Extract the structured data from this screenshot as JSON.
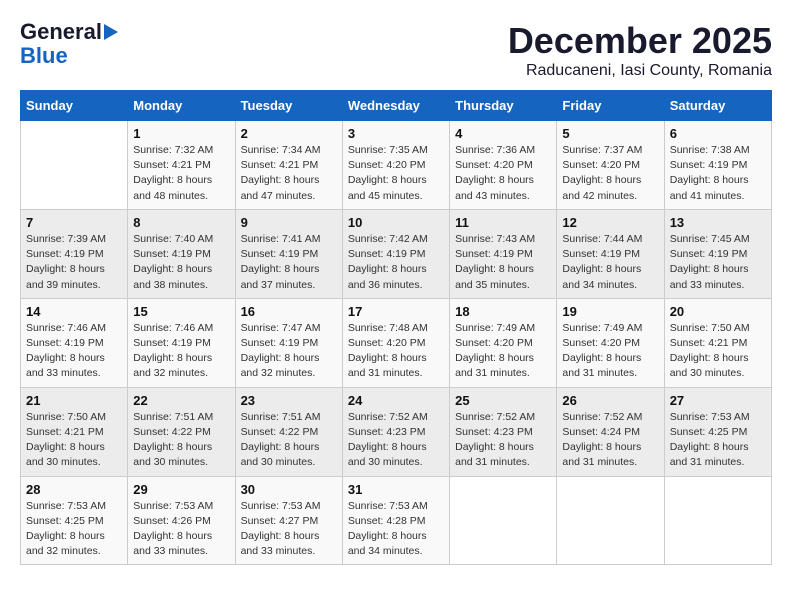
{
  "logo": {
    "line1": "General",
    "line2": "Blue"
  },
  "header": {
    "month": "December 2025",
    "location": "Raducaneni, Iasi County, Romania"
  },
  "weekdays": [
    "Sunday",
    "Monday",
    "Tuesday",
    "Wednesday",
    "Thursday",
    "Friday",
    "Saturday"
  ],
  "weeks": [
    [
      {
        "day": "",
        "sunrise": "",
        "sunset": "",
        "daylight": ""
      },
      {
        "day": "1",
        "sunrise": "Sunrise: 7:32 AM",
        "sunset": "Sunset: 4:21 PM",
        "daylight": "Daylight: 8 hours and 48 minutes."
      },
      {
        "day": "2",
        "sunrise": "Sunrise: 7:34 AM",
        "sunset": "Sunset: 4:21 PM",
        "daylight": "Daylight: 8 hours and 47 minutes."
      },
      {
        "day": "3",
        "sunrise": "Sunrise: 7:35 AM",
        "sunset": "Sunset: 4:20 PM",
        "daylight": "Daylight: 8 hours and 45 minutes."
      },
      {
        "day": "4",
        "sunrise": "Sunrise: 7:36 AM",
        "sunset": "Sunset: 4:20 PM",
        "daylight": "Daylight: 8 hours and 43 minutes."
      },
      {
        "day": "5",
        "sunrise": "Sunrise: 7:37 AM",
        "sunset": "Sunset: 4:20 PM",
        "daylight": "Daylight: 8 hours and 42 minutes."
      },
      {
        "day": "6",
        "sunrise": "Sunrise: 7:38 AM",
        "sunset": "Sunset: 4:19 PM",
        "daylight": "Daylight: 8 hours and 41 minutes."
      }
    ],
    [
      {
        "day": "7",
        "sunrise": "Sunrise: 7:39 AM",
        "sunset": "Sunset: 4:19 PM",
        "daylight": "Daylight: 8 hours and 39 minutes."
      },
      {
        "day": "8",
        "sunrise": "Sunrise: 7:40 AM",
        "sunset": "Sunset: 4:19 PM",
        "daylight": "Daylight: 8 hours and 38 minutes."
      },
      {
        "day": "9",
        "sunrise": "Sunrise: 7:41 AM",
        "sunset": "Sunset: 4:19 PM",
        "daylight": "Daylight: 8 hours and 37 minutes."
      },
      {
        "day": "10",
        "sunrise": "Sunrise: 7:42 AM",
        "sunset": "Sunset: 4:19 PM",
        "daylight": "Daylight: 8 hours and 36 minutes."
      },
      {
        "day": "11",
        "sunrise": "Sunrise: 7:43 AM",
        "sunset": "Sunset: 4:19 PM",
        "daylight": "Daylight: 8 hours and 35 minutes."
      },
      {
        "day": "12",
        "sunrise": "Sunrise: 7:44 AM",
        "sunset": "Sunset: 4:19 PM",
        "daylight": "Daylight: 8 hours and 34 minutes."
      },
      {
        "day": "13",
        "sunrise": "Sunrise: 7:45 AM",
        "sunset": "Sunset: 4:19 PM",
        "daylight": "Daylight: 8 hours and 33 minutes."
      }
    ],
    [
      {
        "day": "14",
        "sunrise": "Sunrise: 7:46 AM",
        "sunset": "Sunset: 4:19 PM",
        "daylight": "Daylight: 8 hours and 33 minutes."
      },
      {
        "day": "15",
        "sunrise": "Sunrise: 7:46 AM",
        "sunset": "Sunset: 4:19 PM",
        "daylight": "Daylight: 8 hours and 32 minutes."
      },
      {
        "day": "16",
        "sunrise": "Sunrise: 7:47 AM",
        "sunset": "Sunset: 4:19 PM",
        "daylight": "Daylight: 8 hours and 32 minutes."
      },
      {
        "day": "17",
        "sunrise": "Sunrise: 7:48 AM",
        "sunset": "Sunset: 4:20 PM",
        "daylight": "Daylight: 8 hours and 31 minutes."
      },
      {
        "day": "18",
        "sunrise": "Sunrise: 7:49 AM",
        "sunset": "Sunset: 4:20 PM",
        "daylight": "Daylight: 8 hours and 31 minutes."
      },
      {
        "day": "19",
        "sunrise": "Sunrise: 7:49 AM",
        "sunset": "Sunset: 4:20 PM",
        "daylight": "Daylight: 8 hours and 31 minutes."
      },
      {
        "day": "20",
        "sunrise": "Sunrise: 7:50 AM",
        "sunset": "Sunset: 4:21 PM",
        "daylight": "Daylight: 8 hours and 30 minutes."
      }
    ],
    [
      {
        "day": "21",
        "sunrise": "Sunrise: 7:50 AM",
        "sunset": "Sunset: 4:21 PM",
        "daylight": "Daylight: 8 hours and 30 minutes."
      },
      {
        "day": "22",
        "sunrise": "Sunrise: 7:51 AM",
        "sunset": "Sunset: 4:22 PM",
        "daylight": "Daylight: 8 hours and 30 minutes."
      },
      {
        "day": "23",
        "sunrise": "Sunrise: 7:51 AM",
        "sunset": "Sunset: 4:22 PM",
        "daylight": "Daylight: 8 hours and 30 minutes."
      },
      {
        "day": "24",
        "sunrise": "Sunrise: 7:52 AM",
        "sunset": "Sunset: 4:23 PM",
        "daylight": "Daylight: 8 hours and 30 minutes."
      },
      {
        "day": "25",
        "sunrise": "Sunrise: 7:52 AM",
        "sunset": "Sunset: 4:23 PM",
        "daylight": "Daylight: 8 hours and 31 minutes."
      },
      {
        "day": "26",
        "sunrise": "Sunrise: 7:52 AM",
        "sunset": "Sunset: 4:24 PM",
        "daylight": "Daylight: 8 hours and 31 minutes."
      },
      {
        "day": "27",
        "sunrise": "Sunrise: 7:53 AM",
        "sunset": "Sunset: 4:25 PM",
        "daylight": "Daylight: 8 hours and 31 minutes."
      }
    ],
    [
      {
        "day": "28",
        "sunrise": "Sunrise: 7:53 AM",
        "sunset": "Sunset: 4:25 PM",
        "daylight": "Daylight: 8 hours and 32 minutes."
      },
      {
        "day": "29",
        "sunrise": "Sunrise: 7:53 AM",
        "sunset": "Sunset: 4:26 PM",
        "daylight": "Daylight: 8 hours and 33 minutes."
      },
      {
        "day": "30",
        "sunrise": "Sunrise: 7:53 AM",
        "sunset": "Sunset: 4:27 PM",
        "daylight": "Daylight: 8 hours and 33 minutes."
      },
      {
        "day": "31",
        "sunrise": "Sunrise: 7:53 AM",
        "sunset": "Sunset: 4:28 PM",
        "daylight": "Daylight: 8 hours and 34 minutes."
      },
      {
        "day": "",
        "sunrise": "",
        "sunset": "",
        "daylight": ""
      },
      {
        "day": "",
        "sunrise": "",
        "sunset": "",
        "daylight": ""
      },
      {
        "day": "",
        "sunrise": "",
        "sunset": "",
        "daylight": ""
      }
    ]
  ]
}
